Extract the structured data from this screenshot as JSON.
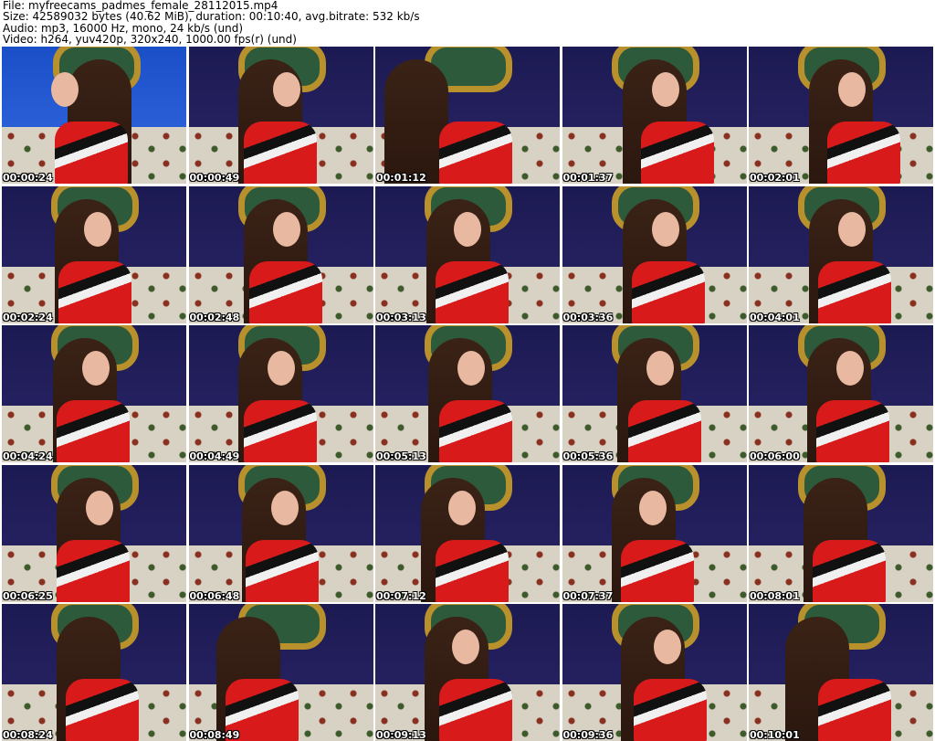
{
  "header": {
    "file_line": "File: myfreecams_padmes_female_28112015.mp4",
    "size_line": "Size: 42589032 bytes (40.62 MiB), duration: 00:10:40, avg.bitrate: 532 kb/s",
    "audio_line": "Audio: mp3, 16000 Hz, mono, 24 kb/s (und)",
    "video_line": "Video: h264, yuv420p, 320x240, 1000.00 fps(r) (und)"
  },
  "thumbnails": [
    {
      "timestamp": "00:00:24"
    },
    {
      "timestamp": "00:00:49"
    },
    {
      "timestamp": "00:01:12"
    },
    {
      "timestamp": "00:01:37"
    },
    {
      "timestamp": "00:02:01"
    },
    {
      "timestamp": "00:02:24"
    },
    {
      "timestamp": "00:02:48"
    },
    {
      "timestamp": "00:03:13"
    },
    {
      "timestamp": "00:03:36"
    },
    {
      "timestamp": "00:04:01"
    },
    {
      "timestamp": "00:04:24"
    },
    {
      "timestamp": "00:04:49"
    },
    {
      "timestamp": "00:05:13"
    },
    {
      "timestamp": "00:05:36"
    },
    {
      "timestamp": "00:06:00"
    },
    {
      "timestamp": "00:06:25"
    },
    {
      "timestamp": "00:06:48"
    },
    {
      "timestamp": "00:07:12"
    },
    {
      "timestamp": "00:07:37"
    },
    {
      "timestamp": "00:08:01"
    },
    {
      "timestamp": "00:08:24"
    },
    {
      "timestamp": "00:08:49"
    },
    {
      "timestamp": "00:09:13"
    },
    {
      "timestamp": "00:09:36"
    },
    {
      "timestamp": "00:10:01"
    }
  ],
  "colors": {
    "timestamp_text": "#ffffff",
    "dress_red": "#d81a1a",
    "frame_gold": "#b8902c",
    "wall_navy": "#1c1a52"
  }
}
